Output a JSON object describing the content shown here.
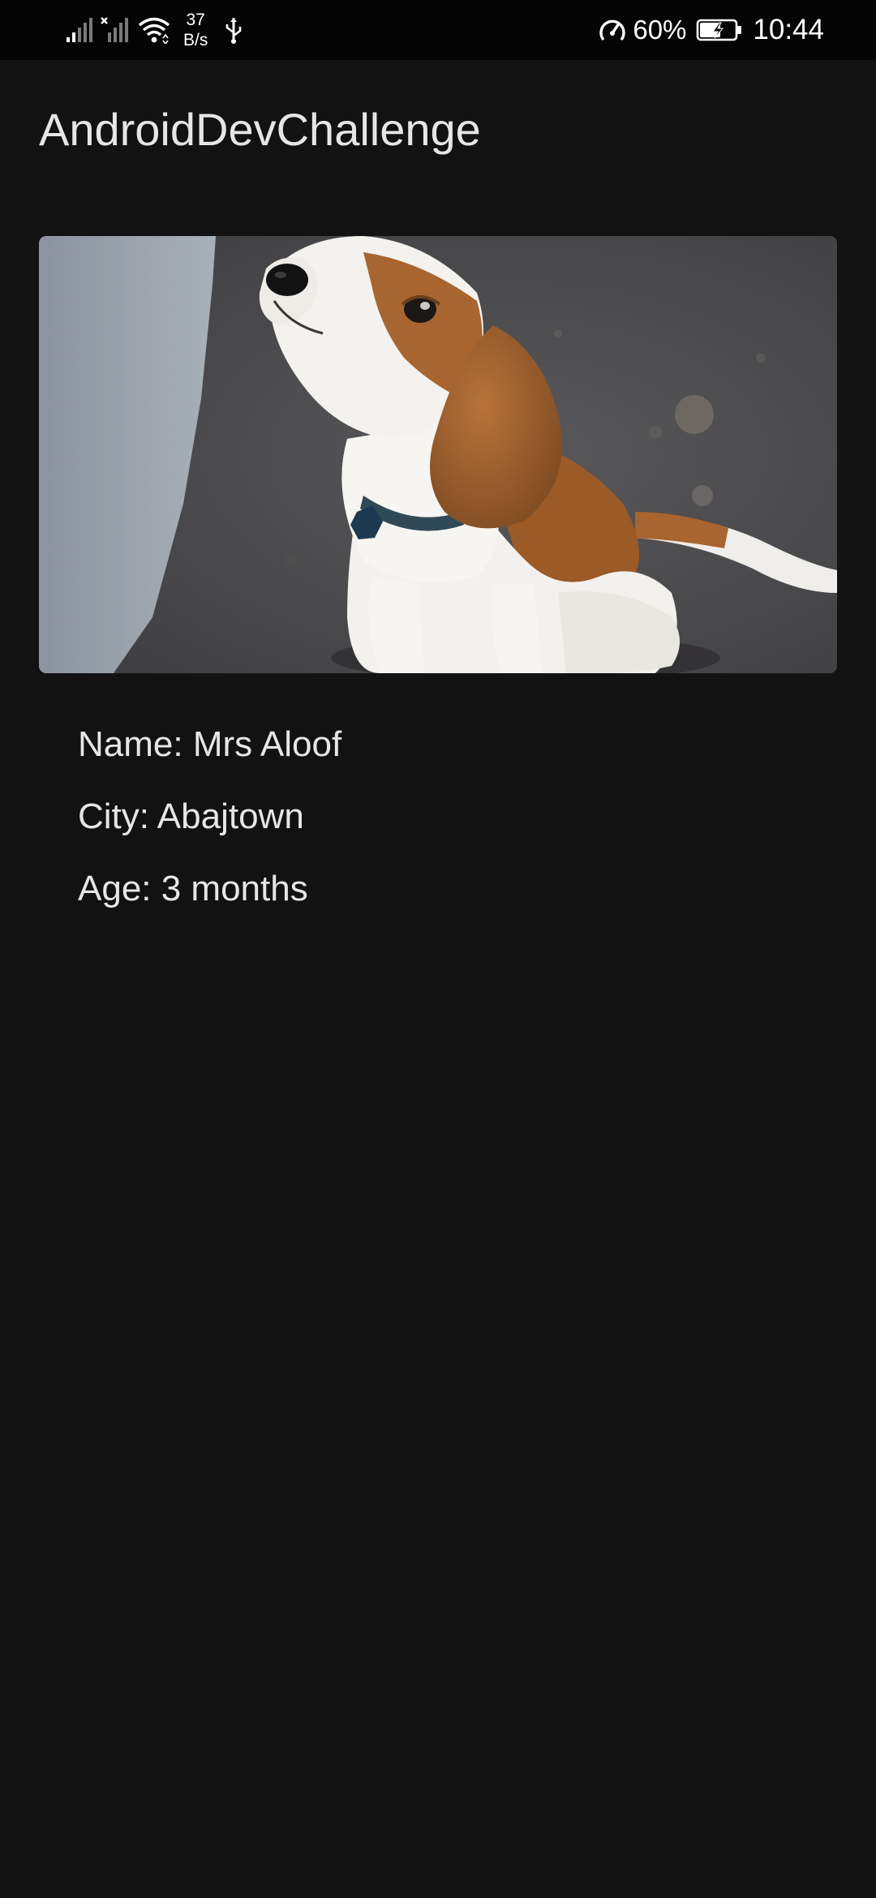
{
  "status_bar": {
    "speed_value": "37",
    "speed_unit": "B/s",
    "battery_percent": "60%",
    "time": "10:44",
    "icons": [
      "signal-icon",
      "signal-no-sim-icon",
      "wifi-icon",
      "usb-icon",
      "speed-boost-icon",
      "battery-charging-icon"
    ]
  },
  "app_bar": {
    "title": "AndroidDevChallenge"
  },
  "puppy": {
    "image_subject": "beagle-puppy-photo",
    "name_line": "Name: Mrs Aloof",
    "city_line": "City: Abajtown",
    "age_line": "Age: 3 months"
  },
  "theme": {
    "background": "#121212",
    "status_bar_background": "#050505",
    "text": "#e6e6e6"
  }
}
